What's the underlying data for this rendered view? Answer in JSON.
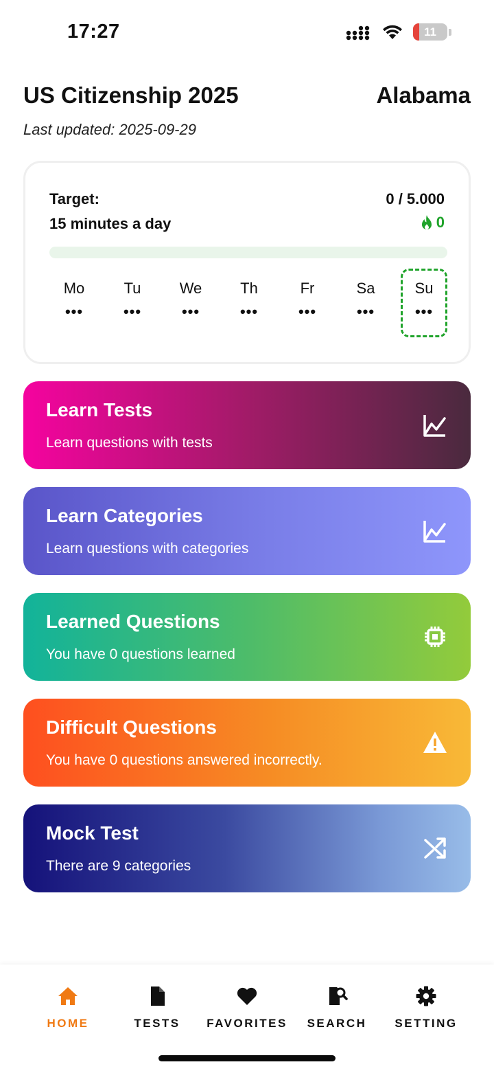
{
  "status_bar": {
    "time": "17:27",
    "battery": "11"
  },
  "header": {
    "title": "US Citizenship 2025",
    "state": "Alabama",
    "last_updated": "Last updated: 2025-09-29"
  },
  "target": {
    "label": "Target:",
    "goal": "15 minutes a day",
    "count": "0 / 5.000",
    "streak": "0",
    "progress": 0,
    "days": [
      {
        "name": "Mo",
        "status": "•••"
      },
      {
        "name": "Tu",
        "status": "•••"
      },
      {
        "name": "We",
        "status": "•••"
      },
      {
        "name": "Th",
        "status": "•••"
      },
      {
        "name": "Fr",
        "status": "•••"
      },
      {
        "name": "Sa",
        "status": "•••"
      },
      {
        "name": "Su",
        "status": "•••"
      }
    ],
    "today": "Su"
  },
  "cards": [
    {
      "title": "Learn Tests",
      "subtitle": "Learn questions with tests",
      "icon": "chart-line-icon"
    },
    {
      "title": "Learn Categories",
      "subtitle": "Learn questions with categories",
      "icon": "chart-line-icon"
    },
    {
      "title": "Learned Questions",
      "subtitle": "You have 0 questions learned",
      "icon": "chip-icon"
    },
    {
      "title": "Difficult Questions",
      "subtitle": "You have 0 questions answered incorrectly.",
      "icon": "warning-icon"
    },
    {
      "title": "Mock Test",
      "subtitle": "There are 9 categories",
      "icon": "shuffle-icon"
    }
  ],
  "nav": {
    "active": "HOME",
    "active_color": "#f07a14",
    "items": [
      {
        "label": "HOME",
        "icon": "home-icon"
      },
      {
        "label": "TESTS",
        "icon": "document-icon"
      },
      {
        "label": "FAVORITES",
        "icon": "heart-icon"
      },
      {
        "label": "SEARCH",
        "icon": "search-document-icon"
      },
      {
        "label": "SETTING",
        "icon": "gear-icon"
      }
    ]
  },
  "colors": {
    "streak_green": "#1fa32a",
    "progress_track": "#e9f5ea"
  }
}
